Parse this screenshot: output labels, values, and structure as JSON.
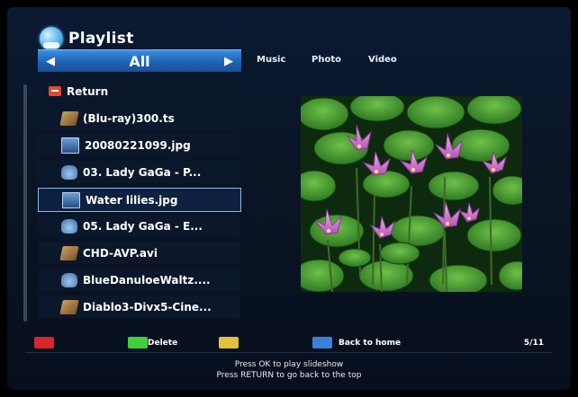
{
  "header": {
    "title": "Playlist",
    "icon": "playlist-icon"
  },
  "tabs": {
    "left_arrow": "◀",
    "right_arrow": "▶",
    "active": "All",
    "others": [
      "Music",
      "Photo",
      "Video"
    ]
  },
  "list": {
    "items": [
      {
        "label": "Return",
        "icon": "return-icon",
        "selected": false
      },
      {
        "label": "(Blu-ray)300.ts",
        "icon": "video-file-icon",
        "selected": false
      },
      {
        "label": "20080221099.jpg",
        "icon": "photo-file-icon",
        "selected": false
      },
      {
        "label": "03. Lady GaGa - P...",
        "icon": "music-file-icon",
        "selected": false
      },
      {
        "label": "Water lilies.jpg",
        "icon": "photo-file-icon",
        "selected": true
      },
      {
        "label": "05. Lady GaGa - E...",
        "icon": "music-file-icon",
        "selected": false
      },
      {
        "label": "CHD-AVP.avi",
        "icon": "video-file-icon",
        "selected": false
      },
      {
        "label": "BlueDanuloeWaltz....",
        "icon": "music-file-icon",
        "selected": false
      },
      {
        "label": "Diablo3-Divx5-Cine...",
        "icon": "video-file-icon",
        "selected": false
      }
    ]
  },
  "footer": {
    "red_label": "",
    "green_label": "Delete",
    "yellow_label": "",
    "blue_label": "Back to home",
    "counter": "5/11",
    "hint_line1": "Press OK to play slideshow",
    "hint_line2": "Press RETURN to go back to the top"
  },
  "colors": {
    "red": "#d8262a",
    "green": "#3fcf3a",
    "yellow": "#e0c23a",
    "blue": "#3b82d6",
    "accent": "#2a78cf"
  }
}
